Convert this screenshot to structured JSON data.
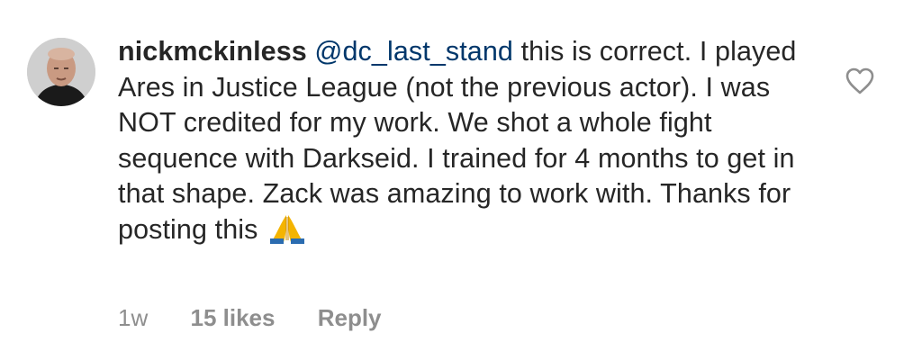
{
  "comment": {
    "username": "nickmckinless",
    "mention": "@dc_last_stand",
    "text": " this is correct. I played Ares in Justice League (not the previous actor). I was NOT credited for my work. We shot a whole fight sequence with Darkseid. I trained for 4 months to get in that shape. Zack was amazing to work with. Thanks for posting this ",
    "emoji": "folded-hands",
    "time": "1w",
    "likes": "15 likes",
    "reply_label": "Reply"
  },
  "icons": {
    "like": "heart-outline-icon",
    "emoji": "folded-hands-icon"
  },
  "colors": {
    "text": "#262626",
    "mention": "#00376b",
    "meta": "#8e8e8e",
    "heart": "#8e8e8e"
  }
}
